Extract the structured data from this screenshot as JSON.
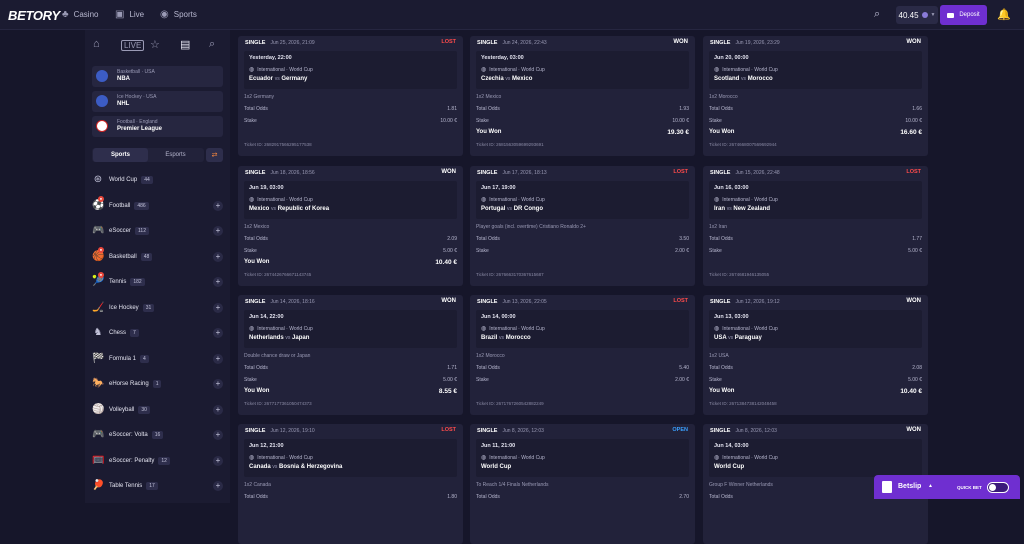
{
  "brand": {
    "logo": "BETORY"
  },
  "nav": {
    "casino": "Casino",
    "live": "Live",
    "sports": "Sports"
  },
  "header": {
    "balance": "40.45",
    "deposit": "Deposit"
  },
  "sidebar": {
    "pins": [
      {
        "sub": "Basketball · USA",
        "name": "NBA",
        "flag": "#3c5cc4"
      },
      {
        "sub": "Ice Hockey · USA",
        "name": "NHL",
        "flag": "#3c5cc4"
      },
      {
        "sub": "Football · England",
        "name": "Premier League",
        "flag": "#ffffff"
      }
    ],
    "tabs": [
      "Sports",
      "Esports"
    ],
    "sports": [
      {
        "name": "World Cup",
        "count": "44"
      },
      {
        "name": "Football",
        "count": "486"
      },
      {
        "name": "eSoccer",
        "count": "112"
      },
      {
        "name": "Basketball",
        "count": "48"
      },
      {
        "name": "Tennis",
        "count": "182"
      },
      {
        "name": "Ice Hockey",
        "count": "31"
      },
      {
        "name": "Chess",
        "count": "7"
      },
      {
        "name": "Formula 1",
        "count": "4"
      },
      {
        "name": "eHorse Racing",
        "count": "1"
      },
      {
        "name": "Volleyball",
        "count": "30"
      },
      {
        "name": "eSoccer: Volta",
        "count": "16"
      },
      {
        "name": "eSoccer: Penalty",
        "count": "12"
      },
      {
        "name": "Table Tennis",
        "count": "17"
      }
    ]
  },
  "bets": [
    {
      "type": "SINGLE",
      "date": "Jun 25, 2026, 21:09",
      "status": "LOST",
      "etime": "Yesterday, 22:00",
      "comp": "International · World Cup",
      "home": "Ecuador",
      "away": "Germany",
      "vs": "vs",
      "sel": "1x2 Germany",
      "odds_label": "Total Odds",
      "odds": "1.81",
      "stake_label": "Stake",
      "stake": "10.00 €",
      "won": "",
      "won_label": "",
      "tid": "Ticket ID: 2682917566295177538"
    },
    {
      "type": "SINGLE",
      "date": "Jun 24, 2026, 22:43",
      "status": "WON",
      "etime": "Yesterday, 03:00",
      "comp": "International · World Cup",
      "home": "Czechia",
      "away": "Mexico",
      "vs": "vs",
      "sel": "1x2 Mexico",
      "odds_label": "Total Odds",
      "odds": "1.93",
      "stake_label": "Stake",
      "stake": "10.00 €",
      "won": "19.30 €",
      "won_label": "You Won",
      "tid": "Ticket ID: 2681563059699293691"
    },
    {
      "type": "SINGLE",
      "date": "Jun 19, 2026, 23:29",
      "status": "WON",
      "etime": "Jun 20, 00:00",
      "comp": "International · World Cup",
      "home": "Scotland",
      "away": "Morocco",
      "vs": "vs",
      "sel": "1x2 Morocco",
      "odds_label": "Total Odds",
      "odds": "1.66",
      "stake_label": "Stake",
      "stake": "10.00 €",
      "won": "16.60 €",
      "won_label": "You Won",
      "tid": "Ticket ID: 2674668007569692944"
    },
    {
      "type": "SINGLE",
      "date": "Jun 18, 2026, 18:56",
      "status": "WON",
      "etime": "Jun 19, 03:00",
      "comp": "International · World Cup",
      "home": "Mexico",
      "away": "Republic of Korea",
      "vs": "vs",
      "sel": "1x2 Mexico",
      "odds_label": "Total Odds",
      "odds": "2.09",
      "stake_label": "Stake",
      "stake": "5.00 €",
      "won": "10.40 €",
      "won_label": "You Won",
      "tid": "Ticket ID: 2674426766671143745"
    },
    {
      "type": "SINGLE",
      "date": "Jun 17, 2026, 18:13",
      "status": "LOST",
      "etime": "Jun 17, 19:00",
      "comp": "International · World Cup",
      "home": "Portugal",
      "away": "DR Congo",
      "vs": "vs",
      "sel": "Player goals (incl. overtime) Cristiano Ronaldo 2+",
      "odds_label": "Total Odds",
      "odds": "3.50",
      "stake_label": "Stake",
      "stake": "2.00 €",
      "won": "",
      "won_label": "",
      "tid": "Ticket ID: 2676663170367615687"
    },
    {
      "type": "SINGLE",
      "date": "Jun 15, 2026, 22:48",
      "status": "LOST",
      "etime": "Jun 16, 03:00",
      "comp": "International · World Cup",
      "home": "Iran",
      "away": "New Zealand",
      "vs": "vs",
      "sel": "1x2 Iran",
      "odds_label": "Total Odds",
      "odds": "1.77",
      "stake_label": "Stake",
      "stake": "5.00 €",
      "won": "",
      "won_label": "",
      "tid": "Ticket ID: 2674681946135055"
    },
    {
      "type": "SINGLE",
      "date": "Jun 14, 2026, 18:16",
      "status": "WON",
      "etime": "Jun 14, 22:00",
      "comp": "International · World Cup",
      "home": "Netherlands",
      "away": "Japan",
      "vs": "vs",
      "sel": "Double chance draw or Japan",
      "odds_label": "Total Odds",
      "odds": "1.71",
      "stake_label": "Stake",
      "stake": "5.00 €",
      "won": "8.55 €",
      "won_label": "You Won",
      "tid": "Ticket ID: 2677177361050474373"
    },
    {
      "type": "SINGLE",
      "date": "Jun 13, 2026, 22:05",
      "status": "LOST",
      "etime": "Jun 14, 00:00",
      "comp": "International · World Cup",
      "home": "Brazil",
      "away": "Morocco",
      "vs": "vs",
      "sel": "1x2 Morocco",
      "odds_label": "Total Odds",
      "odds": "5.40",
      "stake_label": "Stake",
      "stake": "2.00 €",
      "won": "",
      "won_label": "",
      "tid": "Ticket ID: 2671767260542882249"
    },
    {
      "type": "SINGLE",
      "date": "Jun 12, 2026, 19:12",
      "status": "WON",
      "etime": "Jun 13, 03:00",
      "comp": "International · World Cup",
      "home": "USA",
      "away": "Paraguay",
      "vs": "vs",
      "sel": "1x2 USA",
      "odds_label": "Total Odds",
      "odds": "2.08",
      "stake_label": "Stake",
      "stake": "5.00 €",
      "won": "10.40 €",
      "won_label": "You Won",
      "tid": "Ticket ID: 2671384738142048458"
    },
    {
      "type": "SINGLE",
      "date": "Jun 12, 2026, 19:10",
      "status": "LOST",
      "etime": "Jun 12, 21:00",
      "comp": "International · World Cup",
      "home": "Canada",
      "away": "Bosnia & Herzegovina",
      "vs": "vs",
      "sel": "1x2 Canada",
      "odds_label": "Total Odds",
      "odds": "1.80",
      "stake_label": "",
      "stake": "",
      "won": "",
      "won_label": "",
      "tid": ""
    },
    {
      "type": "SINGLE",
      "date": "Jun 8, 2026, 12:03",
      "status": "OPEN",
      "etime": "Jun 11, 21:00",
      "comp": "International · World Cup",
      "home": "World Cup",
      "away": "",
      "vs": "",
      "sel": "To Reach 1/4 Finals Netherlands",
      "odds_label": "Total Odds",
      "odds": "2.70",
      "stake_label": "",
      "stake": "",
      "won": "",
      "won_label": "",
      "tid": ""
    },
    {
      "type": "SINGLE",
      "date": "Jun 8, 2026, 12:03",
      "status": "WON",
      "etime": "Jun 14, 03:00",
      "comp": "International · World Cup",
      "home": "World Cup",
      "away": "",
      "vs": "",
      "sel": "Group F Winner Netherlands",
      "odds_label": "Total Odds",
      "odds": "",
      "stake_label": "",
      "stake": "",
      "won": "",
      "won_label": "",
      "tid": ""
    }
  ],
  "betslip": {
    "label": "Betslip",
    "quickbet": "QUICK BET"
  }
}
